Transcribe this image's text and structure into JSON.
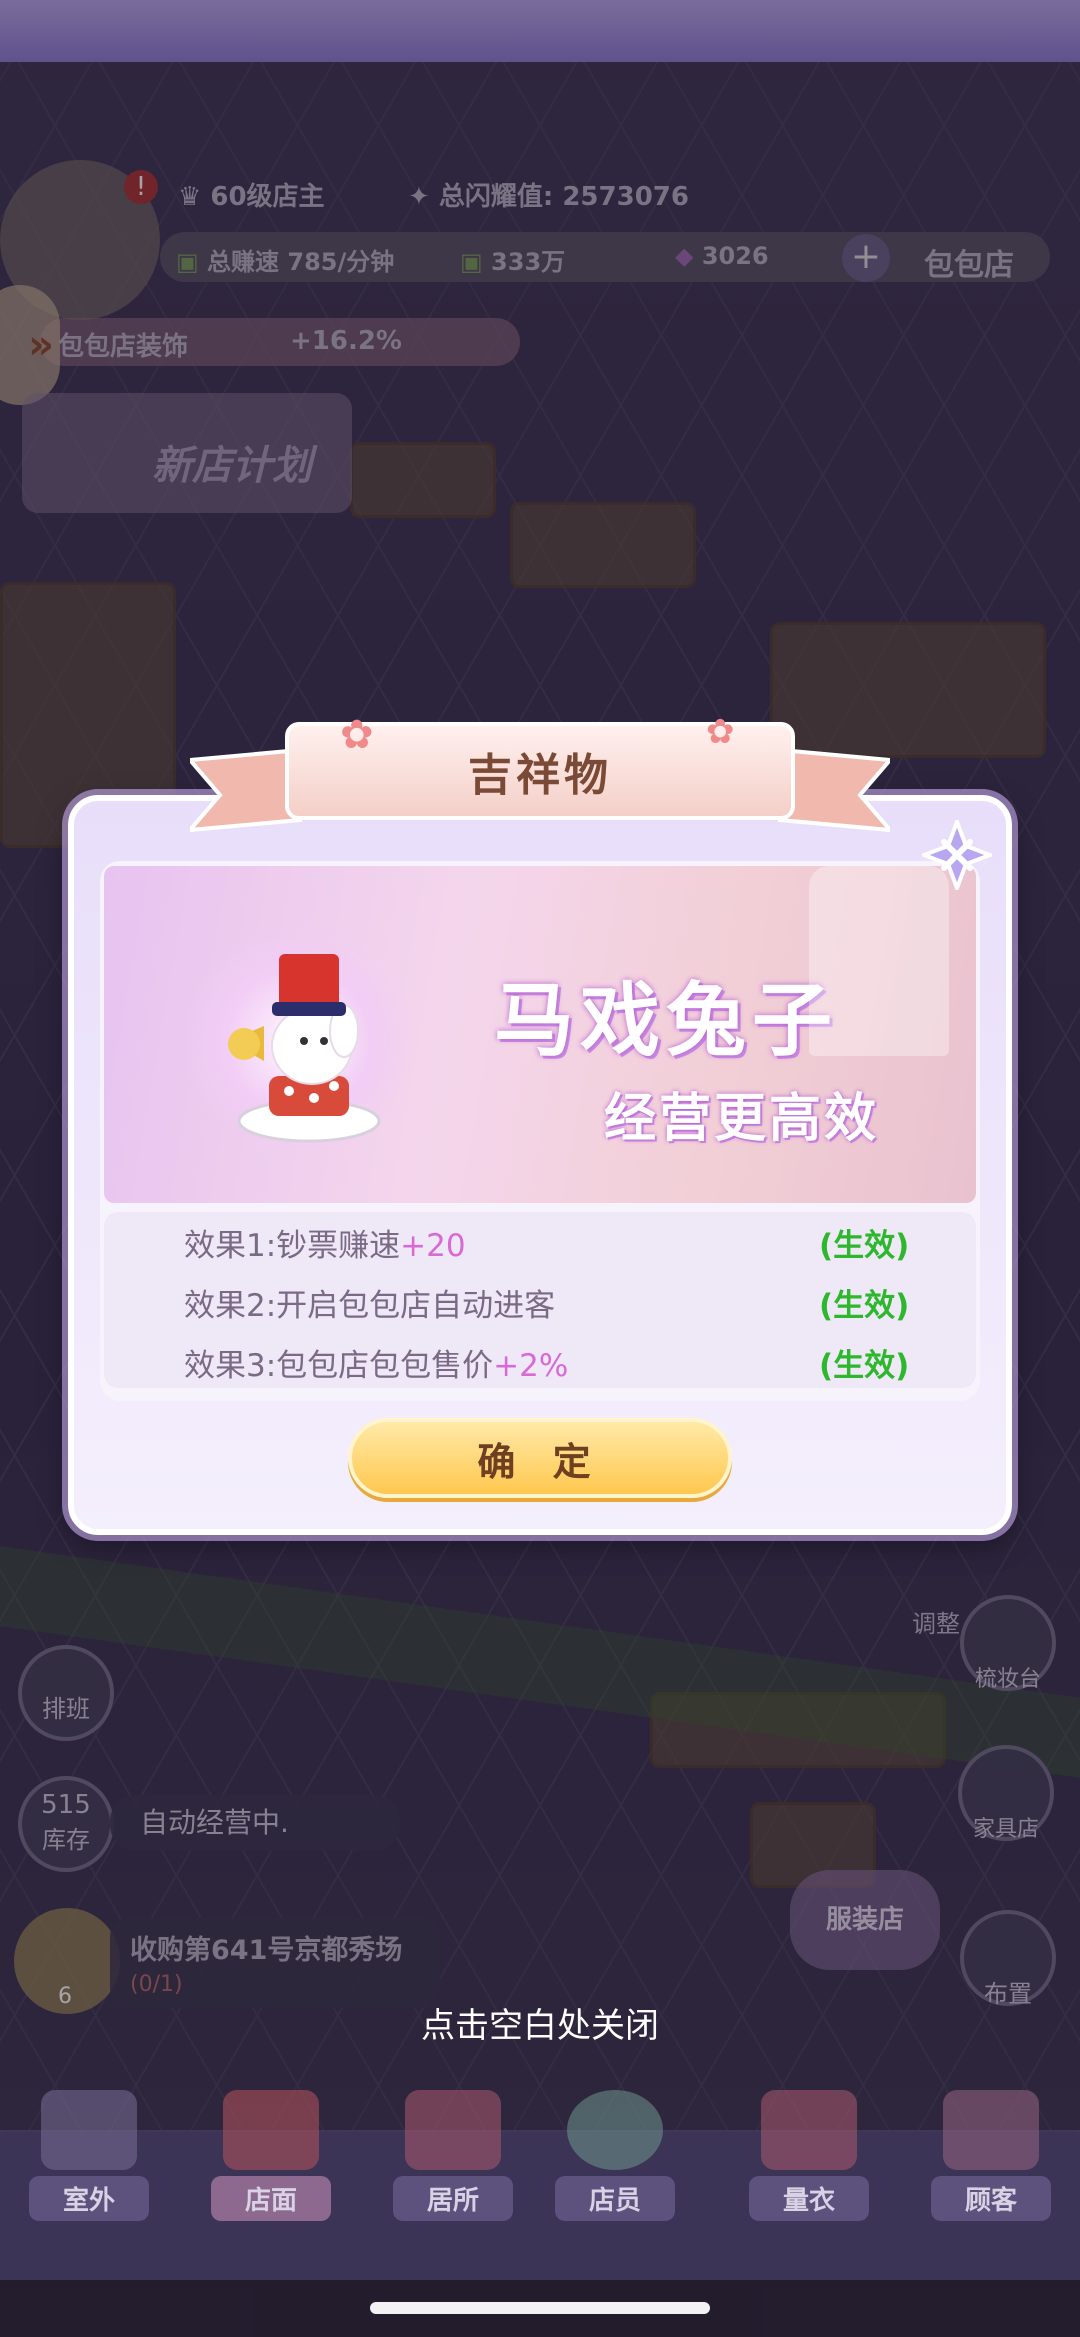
{
  "hud": {
    "level": "60级店主",
    "shine_label": "总闪耀值:",
    "shine_value": "2573076",
    "earn_rate": "总赚速 785/分钟",
    "cash": "333万",
    "gems": "3026",
    "shop_name": "包包店",
    "decor_label": "包包店装饰",
    "decor_bonus": "+16.2%",
    "new_store_plan": "新店计划"
  },
  "side_left": {
    "schedule": "排班",
    "stock_count": "515",
    "stock": "库存",
    "auto_status": "自动经营中.",
    "acquire_title": "收购第641号京都秀场",
    "acquire_progress": "(0/1)",
    "acquire_badge": "6"
  },
  "side_right": {
    "adjust": "调整",
    "dressing_table": "梳妆台",
    "furniture_store": "家具店",
    "clothing_store": "服装店",
    "layout": "布置"
  },
  "dialog": {
    "title": "吉祥物",
    "banner_title": "马戏兔子",
    "banner_subtitle": "经营更高效",
    "effects": [
      {
        "label": "效果1:钞票赚速",
        "value": "+20",
        "status": "(生效)"
      },
      {
        "label": "效果2:开启包包店自动进客",
        "value": "",
        "status": "(生效)"
      },
      {
        "label": "效果3:包包店包包售价",
        "value": "+2%",
        "status": "(生效)"
      }
    ],
    "confirm": "确 定"
  },
  "hint": "点击空白处关闭",
  "nav": [
    {
      "label": "室外"
    },
    {
      "label": "店面"
    },
    {
      "label": "居所"
    },
    {
      "label": "店员"
    },
    {
      "label": "量衣"
    },
    {
      "label": "顾客"
    }
  ],
  "colors": {
    "effect_active": "#2db72d",
    "highlight": "#d86ad6",
    "accent": "#ffc84f"
  }
}
